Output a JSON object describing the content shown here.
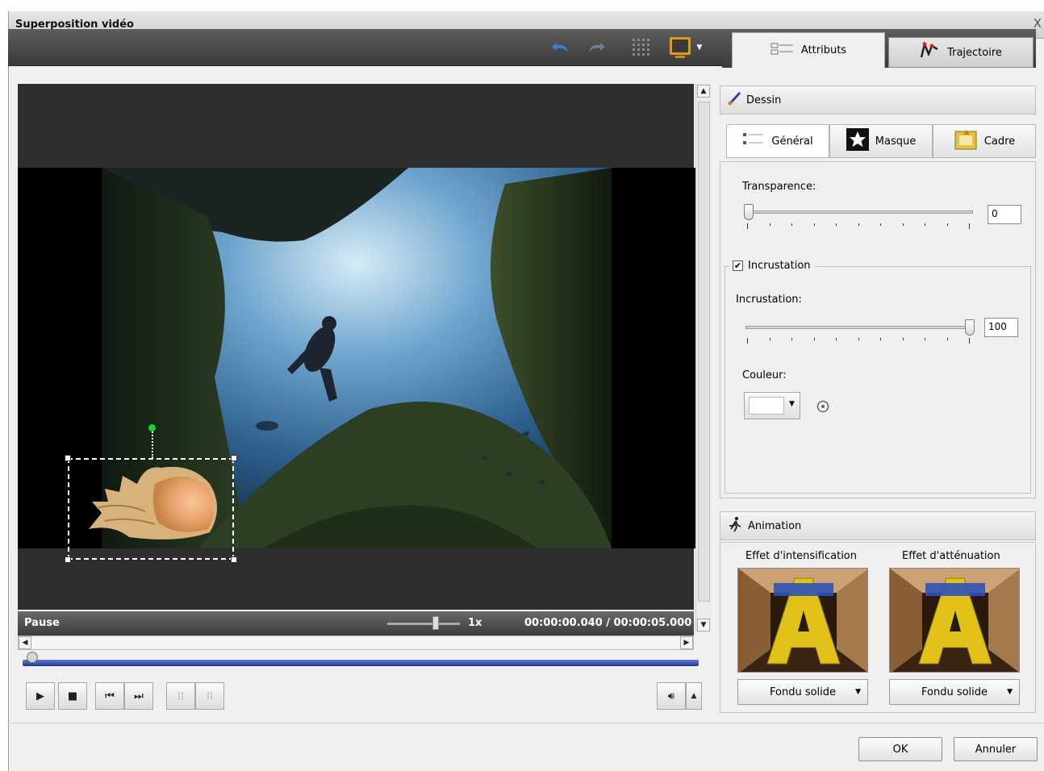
{
  "window": {
    "title": "Superposition vidéo",
    "controls": "_ X"
  },
  "tabs": [
    {
      "label": "Attributs",
      "icon": "attributes-icon",
      "active": true
    },
    {
      "label": "Trajectoire",
      "icon": "trajectory-icon",
      "active": false
    }
  ],
  "drawing_section": {
    "title": "Dessin",
    "subtabs": [
      {
        "label": "Général",
        "icon": "general-list-icon",
        "active": true
      },
      {
        "label": "Masque",
        "icon": "star-mask-icon",
        "active": false
      },
      {
        "label": "Cadre",
        "icon": "frame-icon",
        "active": false
      }
    ],
    "transparency": {
      "label": "Transparence:",
      "value": "0",
      "fraction": 0
    },
    "chroma_key": {
      "checkbox_label": "Incrustation",
      "checked": true,
      "slider_label": "Incrustation:",
      "value": "100",
      "fraction": 1,
      "color_label": "Couleur:",
      "color": "#ffffff"
    }
  },
  "animation_section": {
    "title": "Animation",
    "fade_in": {
      "label": "Effet d'intensification",
      "effect": "Fondu solide"
    },
    "fade_out": {
      "label": "Effet d'atténuation",
      "effect": "Fondu solide"
    }
  },
  "player": {
    "status": "Pause",
    "speed": "1x",
    "time": "00:00:00.040 / 00:00:05.000",
    "progress_fraction": 0.008
  },
  "buttons": {
    "ok": "OK",
    "cancel": "Annuler"
  },
  "colors": {
    "timeline": "#1d3b8a",
    "toolbar": "#4a4a4a",
    "selection_handle_rotate": "#20d030"
  }
}
